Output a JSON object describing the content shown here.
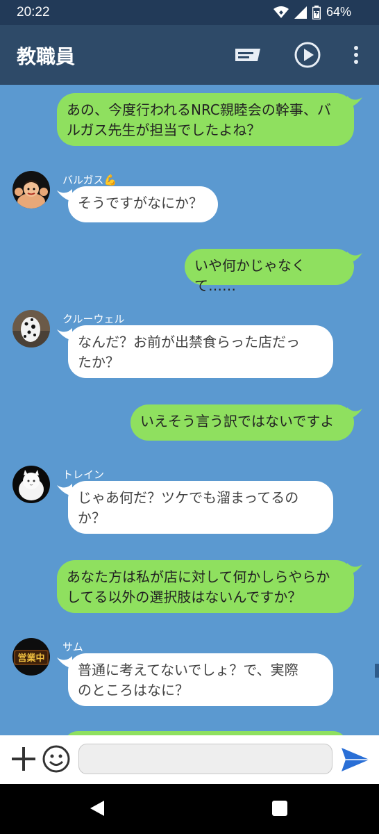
{
  "status_bar": {
    "time": "20:22",
    "battery": "64%"
  },
  "app_bar": {
    "title": "教職員",
    "icons": [
      "note-icon",
      "play-icon",
      "more-vert-icon"
    ]
  },
  "messages": [
    {
      "direction": "out",
      "lines": [
        "あの、今度行われるNRC親睦会の幹事、バ",
        "ルガス先生が担当でしたよね？"
      ]
    },
    {
      "direction": "in",
      "sender": "バルガス💪",
      "lines": [
        "そうですがなにか？"
      ]
    },
    {
      "direction": "out",
      "lines": [
        "いや何かじゃなくて……"
      ]
    },
    {
      "direction": "in",
      "sender": "クルーウェル",
      "lines": [
        "なんだ？お前が出禁食らった店だっ",
        "たか？"
      ]
    },
    {
      "direction": "out",
      "lines": [
        "いえそう言う訳ではないですよ"
      ]
    },
    {
      "direction": "in",
      "sender": "トレイン",
      "lines": [
        "じゃあ何だ？ツケでも溜まってるの",
        "か？"
      ]
    },
    {
      "direction": "out",
      "lines": [
        "あなた方は私が店に対して何かしらやらか",
        "してる以外の選択肢はないんですか？"
      ]
    },
    {
      "direction": "in",
      "sender": "サム",
      "lines": [
        "普通に考えてないでしょ？で、実際",
        "のところはなに？"
      ]
    }
  ],
  "avatar_sign_text": "営業中",
  "input": {
    "value": "",
    "placeholder": ""
  },
  "colors": {
    "chat_bg": "#5b99d0",
    "outgoing_bubble": "#8fe05f",
    "incoming_bubble": "#ffffff",
    "app_bar": "#2e4a68",
    "send": "#2a6fd6"
  }
}
